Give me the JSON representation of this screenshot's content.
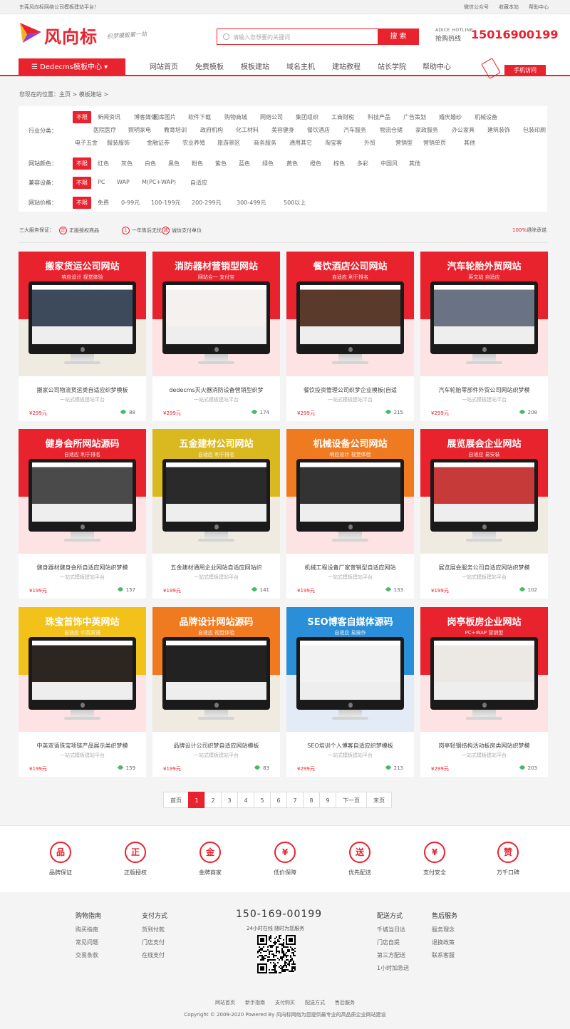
{
  "topbar": {
    "notice": "东莞风向标网络公司模板建站平台！",
    "wechat": "微信公众号",
    "favorite": "收藏本站",
    "help": "帮助中心"
  },
  "header": {
    "brand": "风向标",
    "slogan": "织梦模板第一站",
    "search_placeholder": "请输入您想要的关键词",
    "search_button": "搜 索",
    "hotline_en": "ADICE HOTLINE",
    "hotline_cn": "抢购热线",
    "hotline_number": "15016900199"
  },
  "nav": {
    "category_button": "Dedecms模板中心",
    "items": [
      "网站首页",
      "免费模板",
      "模板建站",
      "域名主机",
      "建站教程",
      "站长学院",
      "帮助中心"
    ],
    "mobile": "手机访问"
  },
  "breadcrumb": "您现在的位置：主页 > 模板建站 >",
  "filters": {
    "industry": {
      "label": "行业分类：",
      "active": "不限",
      "rows": [
        [
          "新闻资讯",
          "博客媒体",
          "图库图片",
          "软件下载",
          "购物商城",
          "网络公司",
          "集团组织",
          "工商财税",
          "科技产品",
          "广告策划",
          "婚庆婚纱",
          "机械设备"
        ],
        [
          "医院医疗",
          "照明家电",
          "教育培训",
          "政府机构",
          "化工材料",
          "美容健身",
          "餐饮酒店",
          "汽车服务",
          "物流仓储",
          "家政服务",
          "办公家具",
          "建筑装饰",
          "包装印刷"
        ],
        [
          "电子五金",
          "服装服饰",
          "金融证券",
          "农业养殖",
          "旅游景区",
          "商务服务",
          "通用其它",
          "淘宝客",
          "外贸",
          "营销型",
          "营销单页",
          "其他"
        ]
      ]
    },
    "color": {
      "label": "网站颜色：",
      "active": "不限",
      "items": [
        "红色",
        "灰色",
        "白色",
        "黑色",
        "粉色",
        "紫色",
        "蓝色",
        "绿色",
        "黄色",
        "橙色",
        "棕色",
        "多彩",
        "中国风",
        "其他"
      ]
    },
    "device": {
      "label": "兼容设备：",
      "active": "不限",
      "items": [
        "PC",
        "WAP",
        "M(PC+WAP)",
        "自适应"
      ]
    },
    "price": {
      "label": "网站价格：",
      "active": "不限",
      "items": [
        "免费",
        "0-99元",
        "100-199元",
        "200-299元",
        "300-499元",
        "500以上"
      ]
    }
  },
  "service": {
    "title": "三大服务保证：",
    "items": [
      "正版授权商品",
      "一年售后无忧",
      "诚信支付单位"
    ],
    "refund_pct": "100%",
    "refund_text": "退除承诺",
    "icons": [
      "正",
      "1",
      "诚"
    ]
  },
  "cards": [
    {
      "banner_title": "搬家货运公司网站",
      "banner_sub": "响应设计   视觉体验",
      "title": "搬家公司物流货运类自适应织梦模板",
      "sub": "一站式模板建站平台",
      "price": "¥299元",
      "views": "88",
      "c1": "#e8232e",
      "c2": "#f0ebe1",
      "screen": "#3d4a5c"
    },
    {
      "banner_title": "消防器材营销型网站",
      "banner_sub": "网站合一   支付宝",
      "title": "dedecms灭火器消防设备营销型织梦",
      "sub": "一站式模板建站平台",
      "price": "¥299元",
      "views": "174",
      "c1": "#e8232e",
      "c2": "#fde3e3",
      "screen": "#f4f1ee"
    },
    {
      "banner_title": "餐饮酒店公司网站",
      "banner_sub": "自适应   利于排名",
      "title": "餐饮投资管理公司织梦企业模板(自适",
      "sub": "一站式模板建站平台",
      "price": "¥299元",
      "views": "215",
      "c1": "#e8232e",
      "c2": "#fde3e3",
      "screen": "#5a3a2a"
    },
    {
      "banner_title": "汽车轮胎外贸网站",
      "banner_sub": "英文站   自适应",
      "title": "汽车轮胎零部件外贸公司网站织梦模",
      "sub": "一站式模板建站平台",
      "price": "¥299元",
      "views": "208",
      "c1": "#e8232e",
      "c2": "#fde3e3",
      "screen": "#6a7384"
    },
    {
      "banner_title": "健身会所网站源码",
      "banner_sub": "自适应   利于排名",
      "title": "健身器材健身会所自适应网站织梦模",
      "sub": "一站式模板建站平台",
      "price": "¥199元",
      "views": "157",
      "c1": "#e8232e",
      "c2": "#fde3e3",
      "screen": "#4a4a4a"
    },
    {
      "banner_title": "五金建材公司网站",
      "banner_sub": "自适应   利于排名",
      "title": "五金建材通用企业网站自适应网站织",
      "sub": "一站式模板建站平台",
      "price": "¥199元",
      "views": "141",
      "c1": "#d9b820",
      "c2": "#f0ebe1",
      "screen": "#2a2a2a"
    },
    {
      "banner_title": "机械设备公司网站",
      "banner_sub": "响应设计   视觉体验",
      "title": "机械工程设备厂家营销型自适应网站",
      "sub": "一站式模板建站平台",
      "price": "¥199元",
      "views": "133",
      "c1": "#f07a20",
      "c2": "#fde3e3",
      "screen": "#333"
    },
    {
      "banner_title": "展览展会企业网站",
      "banner_sub": "自适应   易安装",
      "title": "展览展会服务公司自适应网站织梦模",
      "sub": "一站式模板建站平台",
      "price": "¥199元",
      "views": "102",
      "c1": "#e8232e",
      "c2": "#f0ebe1",
      "screen": "#c73a3a"
    },
    {
      "banner_title": "珠宝首饰中英网站",
      "banner_sub": "自适应   中英双语",
      "title": "中英双语珠宝项链产品展示类织梦模",
      "sub": "一站式模板建站平台",
      "price": "¥199元",
      "views": "159",
      "c1": "#f2c21a",
      "c2": "#fde3e3",
      "screen": "#2d2520"
    },
    {
      "banner_title": "品牌设计网站源码",
      "banner_sub": "自适应   视觉体验",
      "title": "品牌设计公司织梦自适应网站模板",
      "sub": "一站式模板建站平台",
      "price": "¥199元",
      "views": "83",
      "c1": "#f07a20",
      "c2": "#f0ebe1",
      "screen": "#222"
    },
    {
      "banner_title": "SEO博客自媒体源码",
      "banner_sub": "自适应   易操作",
      "title": "SEO培训个人博客自适应织梦模板",
      "sub": "一站式模板建站平台",
      "price": "¥299元",
      "views": "213",
      "c1": "#2a8fd8",
      "c2": "#e2ebf6",
      "screen": "#f2f2f2"
    },
    {
      "banner_title": "岗亭板房企业网站",
      "banner_sub": "PC+WAP   营销型",
      "title": "岗亭轻钢结构活动板房类网站织梦模",
      "sub": "一站式模板建站平台",
      "price": "¥299元",
      "views": "203",
      "c1": "#e8232e",
      "c2": "#fde3e3",
      "screen": "#ece8e4"
    }
  ],
  "pager": {
    "first": "首页",
    "pages": [
      "1",
      "2",
      "3",
      "4",
      "5",
      "6",
      "7",
      "8",
      "9"
    ],
    "next": "下一页",
    "last": "末页",
    "current": "1"
  },
  "features": [
    {
      "label": "品牌保证",
      "glyph": "品"
    },
    {
      "label": "正版授权",
      "glyph": "正"
    },
    {
      "label": "金牌商家",
      "glyph": "金"
    },
    {
      "label": "低价保障",
      "glyph": "¥"
    },
    {
      "label": "优先配送",
      "glyph": "送"
    },
    {
      "label": "支付安全",
      "glyph": "¥"
    },
    {
      "label": "万千口碑",
      "glyph": "赞"
    }
  ],
  "footer": {
    "cols": [
      {
        "title": "购物指南",
        "items": [
          "购买指南",
          "常见问题",
          "交易条款"
        ]
      },
      {
        "title": "支付方式",
        "items": [
          "货到付款",
          "门店支付",
          "在线支付"
        ]
      },
      {
        "title": "配送方式",
        "items": [
          "千城当日达",
          "门店自提",
          "第三方配送",
          "1小时加急送"
        ]
      },
      {
        "title": "售后服务",
        "items": [
          "服务理念",
          "退换政策",
          "联系客服"
        ]
      }
    ],
    "phone": "150-169-00199",
    "hours": "24小时在线 随时为您服务",
    "links": [
      "网站首页",
      "新手指南",
      "支付购买",
      "配送方式",
      "售后服务"
    ],
    "copyright": "Copyright © 2009-2020 Powered By 风向标网络为您提供最专业的高品质企业网站建设"
  },
  "colors": {
    "accent": "#e8232e"
  }
}
